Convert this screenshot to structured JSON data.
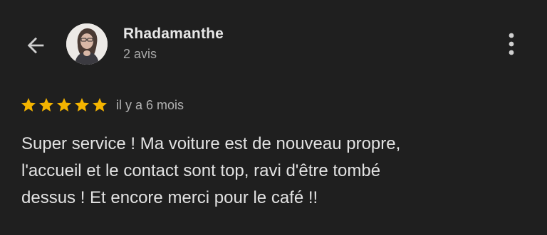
{
  "reviewer": {
    "name": "Rhadamanthe",
    "review_count": "2 avis"
  },
  "review": {
    "rating": 5,
    "rating_max": 5,
    "date": "il y a 6 mois",
    "text_lines": [
      "Super service ! Ma voiture est de nouveau propre,",
      "l'accueil et le contact sont top, ravi d'être tombé",
      "dessus ! Et encore merci pour le café !!"
    ]
  },
  "icons": {
    "back": "arrow-back-icon",
    "more": "more-vert-icon",
    "star": "star-icon"
  },
  "colors": {
    "background": "#1f1f1f",
    "star": "#f4b400",
    "primary_text": "#e8e8e8",
    "secondary_text": "#a9a9a9"
  }
}
